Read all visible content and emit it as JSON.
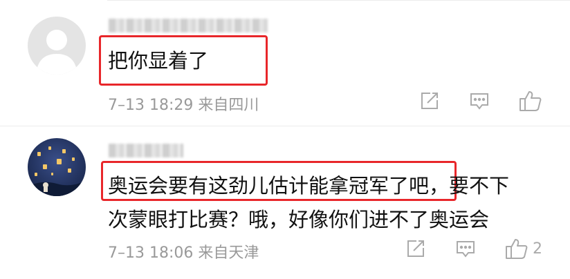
{
  "comments": [
    {
      "username": "████ ██████",
      "text": "把你显着了",
      "time": "7–13 18:29",
      "location": "来自四川",
      "like_count": ""
    },
    {
      "username": "███ ██",
      "text_line1": "奥运会要有这劲儿估计能拿冠军了吧，要不下",
      "text_line2": "次蒙眼打比赛？哦，好像你们进不了奥运会",
      "time": "7–13 18:06",
      "location": "来自天津",
      "like_count": "2"
    }
  ],
  "icons": [
    "share-icon",
    "comment-icon",
    "thumbs-up-icon"
  ],
  "colors": {
    "highlight": "#e8262a",
    "meta_text": "#999999",
    "icon": "#aaaaaa"
  }
}
